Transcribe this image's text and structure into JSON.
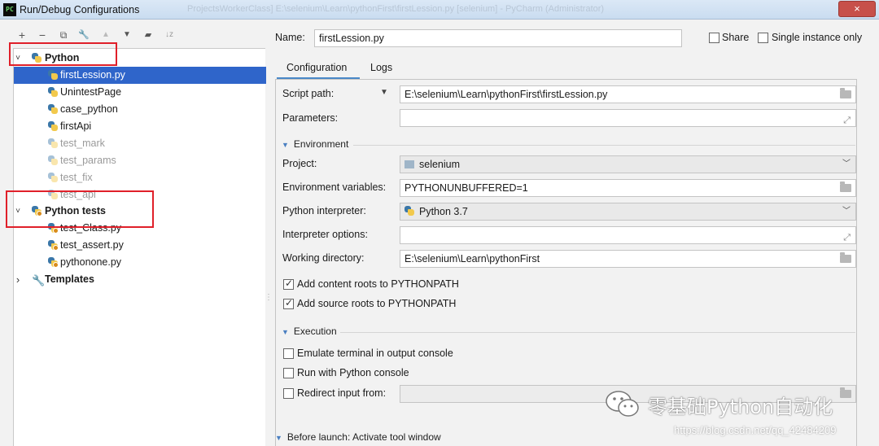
{
  "window": {
    "title": "Run/Debug Configurations",
    "title_ghost": "ProjectsWorkerClass]  E:\\selenium\\Learn\\pythonFirst\\firstLession.py [selenium] - PyCharm (Administrator)",
    "app_icon_text": "PC",
    "close_label": "×"
  },
  "toolbar": {
    "add": "+",
    "remove": "−",
    "copy": "⧉",
    "edit": "🔧",
    "up": "▲",
    "down": "▼",
    "folder": "▰",
    "sort": "↓z"
  },
  "tree": {
    "groups": [
      {
        "label": "Python",
        "expanded": "˅"
      },
      {
        "label": "Python tests",
        "expanded": "˅"
      },
      {
        "label": "Templates",
        "expanded": "›"
      }
    ],
    "python_items": [
      "firstLession.py",
      "UnintestPage",
      "case_python",
      "firstApi",
      "test_mark",
      "test_params",
      "test_fix",
      "test_api"
    ],
    "test_items": [
      "test_Class.py",
      "test_assert.py",
      "pythonone.py"
    ]
  },
  "form": {
    "name_label": "Name:",
    "name_value": "firstLession.py",
    "share_label": "Share",
    "single_instance_label": "Single instance only",
    "tabs": [
      "Configuration",
      "Logs"
    ],
    "script_path_label": "Script path:",
    "script_path_value": "E:\\selenium\\Learn\\pythonFirst\\firstLession.py",
    "parameters_label": "Parameters:",
    "parameters_value": "",
    "environment_section": "Environment",
    "project_label": "Project:",
    "project_value": "selenium",
    "env_vars_label": "Environment variables:",
    "env_vars_value": "PYTHONUNBUFFERED=1",
    "interpreter_label": "Python interpreter:",
    "interpreter_value": "Python 3.7",
    "interp_options_label": "Interpreter options:",
    "interp_options_value": "",
    "working_dir_label": "Working directory:",
    "working_dir_value": "E:\\selenium\\Learn\\pythonFirst",
    "add_content_roots": "Add content roots to PYTHONPATH",
    "add_source_roots": "Add source roots to PYTHONPATH",
    "execution_section": "Execution",
    "emulate_terminal": "Emulate terminal in output console",
    "run_python_console": "Run with Python console",
    "redirect_input": "Redirect input from:",
    "redirect_value": "",
    "before_launch": "Before launch: Activate tool window"
  },
  "watermark": {
    "text": "零基础Python自动化",
    "url": "https://blog.csdn.net/qq_42484209"
  }
}
